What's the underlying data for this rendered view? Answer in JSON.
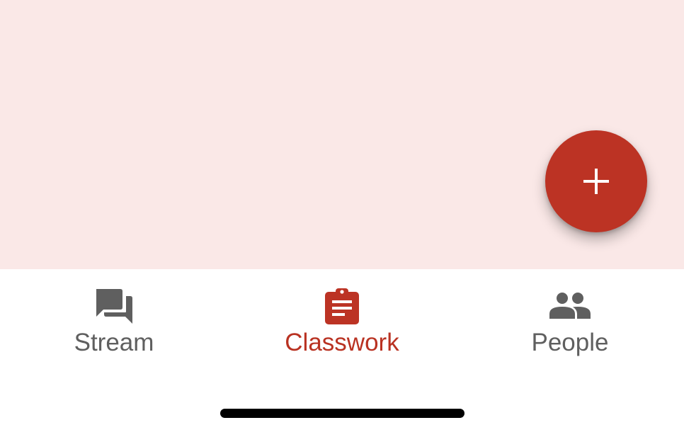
{
  "colors": {
    "content_background": "#fae8e7",
    "accent": "#bc3324",
    "active_label": "#b93222",
    "inactive": "#5f5f5f",
    "nav_background": "#ffffff"
  },
  "fab": {
    "icon": "plus-icon"
  },
  "bottom_nav": {
    "items": [
      {
        "label": "Stream",
        "icon": "stream-chat-icon",
        "active": false
      },
      {
        "label": "Classwork",
        "icon": "clipboard-icon",
        "active": true
      },
      {
        "label": "People",
        "icon": "people-icon",
        "active": false
      }
    ]
  }
}
